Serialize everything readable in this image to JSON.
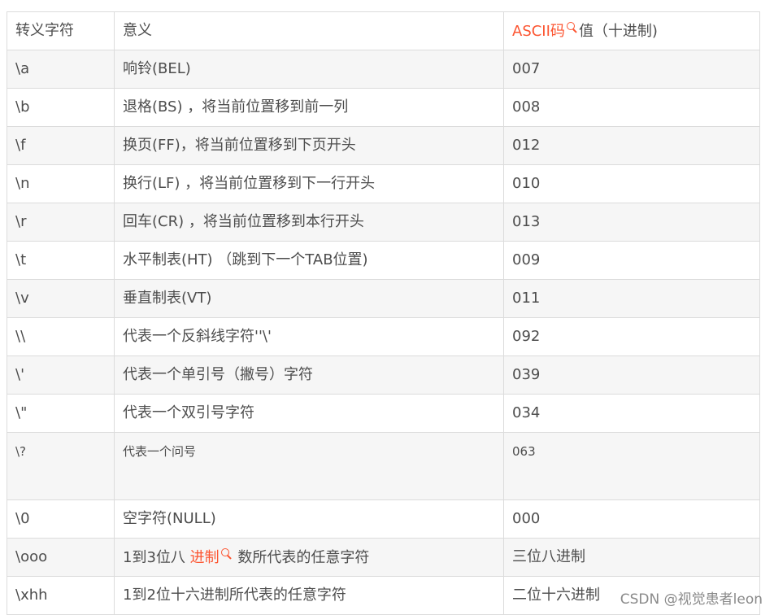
{
  "table": {
    "headers": {
      "col1": "转义字符",
      "col2": "意义",
      "col3_link": "ASCII码",
      "col3_rest": "值（十进制)"
    },
    "rows": [
      {
        "esc": "\\a",
        "meaning": "响铃(BEL)",
        "code": "007"
      },
      {
        "esc": "\\b",
        "meaning": "退格(BS) ，将当前位置移到前一列",
        "code": "008"
      },
      {
        "esc": "\\f",
        "meaning": "换页(FF)，将当前位置移到下页开头",
        "code": "012"
      },
      {
        "esc": "\\n",
        "meaning": "换行(LF) ，将当前位置移到下一行开头",
        "code": "010"
      },
      {
        "esc": "\\r",
        "meaning": "回车(CR) ，将当前位置移到本行开头",
        "code": "013"
      },
      {
        "esc": "\\t",
        "meaning": "水平制表(HT) （跳到下一个TAB位置)",
        "code": "009"
      },
      {
        "esc": "\\v",
        "meaning": "垂直制表(VT)",
        "code": "011"
      },
      {
        "esc": "\\\\",
        "meaning": "代表一个反斜线字符''\\'",
        "code": "092"
      },
      {
        "esc": "\\'",
        "meaning": "代表一个单引号（撇号）字符",
        "code": "039"
      },
      {
        "esc": "\\\"",
        "meaning": "代表一个双引号字符",
        "code": "034"
      },
      {
        "esc": "\\?",
        "meaning": "代表一个问号",
        "code": "063"
      },
      {
        "esc": "\\0",
        "meaning": "空字符(NULL)",
        "code": "000"
      },
      {
        "esc": "\\ooo",
        "meaning_pre": "1到3位八 ",
        "meaning_link": "进制",
        "meaning_post": " 数所代表的任意字符",
        "code": "三位八进制"
      },
      {
        "esc": "\\xhh",
        "meaning": "1到2位十六进制所代表的任意字符",
        "code": "二位十六进制"
      }
    ]
  },
  "watermark": "CSDN @视觉患者leon",
  "colors": {
    "link": "#fc5531",
    "text": "#4d4d4d",
    "border": "#dcdcdc",
    "stripe": "#f6f6f6"
  },
  "icons": {
    "search": "search-icon"
  }
}
